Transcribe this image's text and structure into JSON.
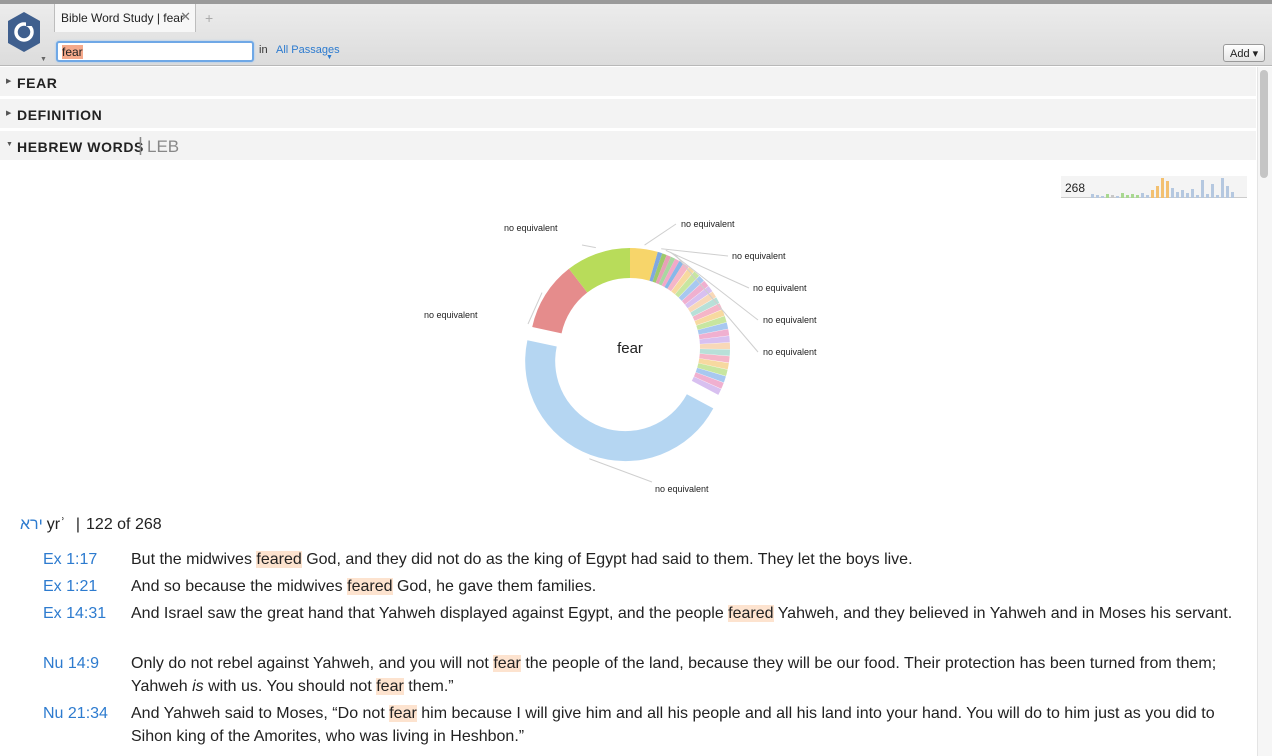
{
  "tab": {
    "title": "Bible Word Study | fear",
    "close": "✕",
    "add": "+"
  },
  "search": {
    "query": "fear",
    "in_label": "in",
    "scope": "All Passages",
    "add_button": "Add ▾"
  },
  "sections": [
    {
      "label": "FEAR",
      "expanded": false
    },
    {
      "label": "DEFINITION",
      "expanded": false
    },
    {
      "label": "HEBREW WORDS",
      "expanded": true,
      "version": "LEB"
    }
  ],
  "sparkline": {
    "count": "268"
  },
  "chart_data": {
    "type": "pie",
    "center_label": "fear",
    "slices": [
      {
        "label": "no equivalent",
        "value": 122,
        "color": "#b5d6f2"
      },
      {
        "label": "no equivalent",
        "value": 30,
        "color": "#e58c8c"
      },
      {
        "label": "no equivalent",
        "value": 28,
        "color": "#b8dc5a"
      },
      {
        "label": "no equivalent",
        "value": 12,
        "color": "#f7d56a"
      },
      {
        "label": "no equivalent",
        "value": 2,
        "color": "#7fa8e0"
      },
      {
        "label": "no equivalent",
        "value": 2,
        "color": "#9ec96b"
      },
      {
        "label": "no equivalent",
        "value": 2,
        "color": "#e8a0b8"
      },
      {
        "label": "no equivalent",
        "value": 2,
        "color": "#a8d8a0"
      },
      {
        "label": "no equivalent",
        "value": 2,
        "color": "#f3a8c8"
      },
      {
        "label": "no equivalent",
        "value": 2,
        "color": "#88b8e8"
      },
      {
        "label": "",
        "value": 64,
        "color": "#f0c8d8"
      }
    ]
  },
  "lemma": {
    "hebrew": "ירא",
    "translit": "yrʾ",
    "count": "122 of 268",
    "sep": "|"
  },
  "verses": [
    {
      "ref": "Ex 1:17",
      "parts": [
        "But the midwives ",
        "feared",
        " God, and they did not do as the king of Egypt had said to them. They let the boys live."
      ]
    },
    {
      "ref": "Ex 1:21",
      "parts": [
        "And so because the midwives ",
        "feared",
        " God, he gave them families."
      ]
    },
    {
      "ref": "Ex 14:31",
      "parts": [
        "And Israel saw the great hand that Yahweh displayed against Egypt, and the people ",
        "feared",
        " Yahweh, and they believed in Yahweh and in Moses his servant."
      ]
    },
    {
      "ref": "Nu 14:9",
      "parts": [
        "Only do not rebel against Yahweh, and you will not ",
        "fear",
        " the people of the land, because they will be our food. Their protection has been turned from them; Yahweh ",
        "is",
        " with us. You should not ",
        "fear",
        " them.”"
      ]
    },
    {
      "ref": "Nu 21:34",
      "parts": [
        "And Yahweh said to Moses, “Do not ",
        "fear",
        " him because I will give him and all his people and all his land into your hand. You will do to him just as you did to Sihon king of the Amorites, who was living in Heshbon.”"
      ]
    }
  ]
}
